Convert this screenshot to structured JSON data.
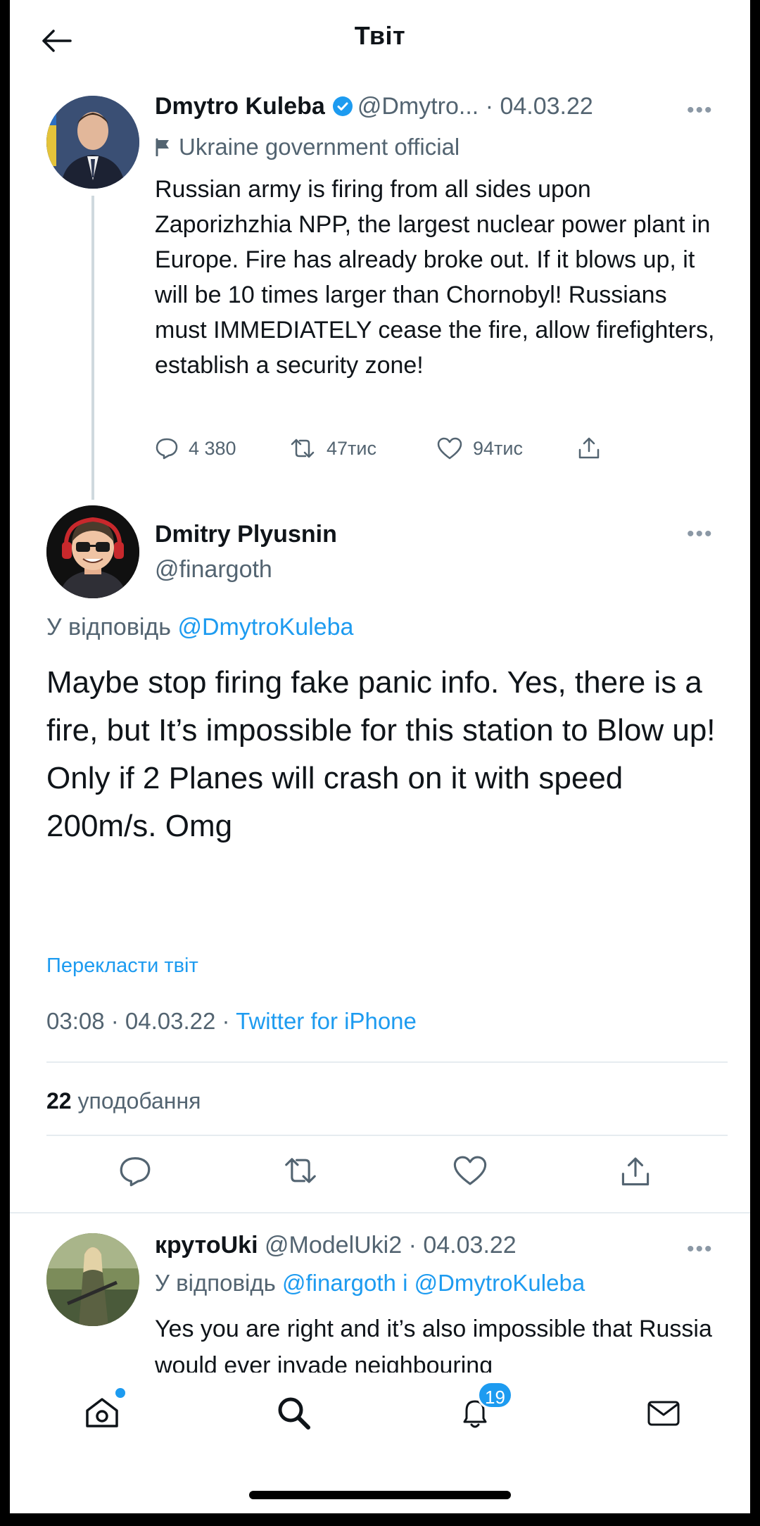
{
  "header": {
    "title": "Твіт"
  },
  "original_tweet": {
    "name": "Dmytro Kuleba",
    "handle": "@Dmytro...",
    "date": "· 04.03.22",
    "label": "Ukraine government official",
    "text": "Russian army is firing from all sides upon Zaporizhzhia NPP, the largest nuclear power plant in Europe. Fire has already broke out. If it blows up, it will be 10 times larger than Chornobyl! Russians must IMMEDIATELY cease the fire, allow firefighters, establish a security zone!",
    "replies": "4 380",
    "retweets": "47тис",
    "likes": "94тис"
  },
  "main_tweet": {
    "name": "Dmitry Plyusnin",
    "handle": "@finargoth",
    "reply_prefix": "У відповідь",
    "reply_to": "@DmytroKuleba",
    "text": "Maybe stop firing fake panic info. Yes, there is a fire, but It’s impossible for this station to Blow up! Only if 2 Planes will crash on it with speed 200m/s. Omg",
    "translate": "Перекласти твіт",
    "time": "03:08 · 04.03.22 ·",
    "source": "Twitter for iPhone",
    "likes_count": "22",
    "likes_label": "уподобання"
  },
  "reply_tweet": {
    "name": "крутоUki",
    "handle": "@ModelUki2",
    "date": "· 04.03.22",
    "reply_prefix": "У відповідь",
    "reply_to_1": "@finargoth",
    "reply_join": "і",
    "reply_to_2": "@DmytroKuleba",
    "text": "Yes you are right and it’s also impossible that Russia would ever invade neighbouring"
  },
  "bottom_nav": {
    "notifications_badge": "19"
  },
  "more_glyph": "•••",
  "colors": {
    "accent": "#1d9bf0",
    "muted": "#536471",
    "text": "#0f1419"
  }
}
